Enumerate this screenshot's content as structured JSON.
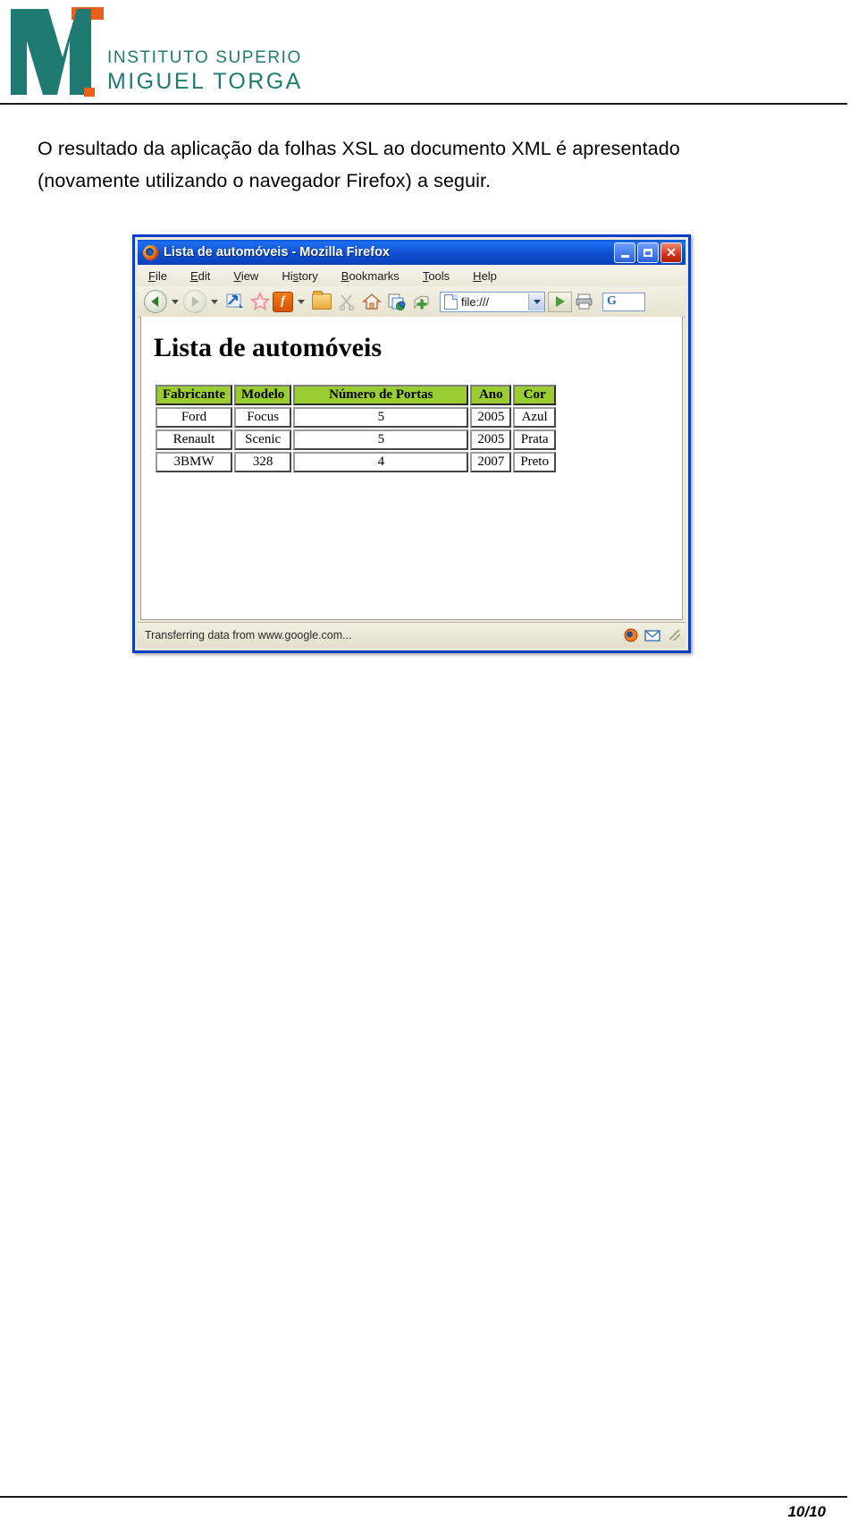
{
  "header": {
    "logo_alt": "Instituto Superior Miguel Torga",
    "logo_line1": "INSTITUTO SUPERIOR",
    "logo_line2": "MIGUEL TORGA",
    "logo_color_teal": "#1f7a73",
    "logo_color_orange": "#e8601c"
  },
  "paragraph": {
    "line1": "O resultado da aplicação da folhas XSL ao documento XML é apresentado",
    "line2": "(novamente utilizando o navegador Firefox) a seguir."
  },
  "browser": {
    "window_title": "Lista de automóveis - Mozilla Firefox",
    "window_buttons": {
      "minimize": "_",
      "maximize": "□",
      "close": "✕"
    },
    "menu": [
      {
        "label": "File",
        "accesskey": "F"
      },
      {
        "label": "Edit",
        "accesskey": "E"
      },
      {
        "label": "View",
        "accesskey": "V"
      },
      {
        "label": "History",
        "accesskey": "s"
      },
      {
        "label": "Bookmarks",
        "accesskey": "B"
      },
      {
        "label": "Tools",
        "accesskey": "T"
      },
      {
        "label": "Help",
        "accesskey": "H"
      }
    ],
    "toolbar": {
      "back_icon": "back-arrow-icon",
      "forward_icon": "forward-arrow-icon",
      "reload_icon": "reload-icon",
      "bookmark_star_icon": "star-icon",
      "firefox_f_button": "f",
      "open_folder_icon": "open-folder-icon",
      "cut_icon": "cut-icon",
      "home_icon": "home-icon",
      "page_copy_icon": "copy-page-icon",
      "add_icon": "add-green-plus-icon",
      "print_icon": "print-icon",
      "search_engine_letter": "G"
    },
    "address_bar": {
      "value": "file:///",
      "placeholder": "file:///"
    },
    "content": {
      "heading": "Lista de automóveis",
      "table": {
        "columns": [
          "Fabricante",
          "Modelo",
          "Número de Portas",
          "Ano",
          "Cor"
        ],
        "rows": [
          [
            "Ford",
            "Focus",
            "5",
            "2005",
            "Azul"
          ],
          [
            "Renault",
            "Scenic",
            "5",
            "2005",
            "Prata"
          ],
          [
            "3BMW",
            "328",
            "4",
            "2007",
            "Preto"
          ]
        ]
      }
    },
    "status_bar": {
      "text": "Transferring data from www.google.com...",
      "icons": [
        "firefox-status-icon",
        "mail-icon",
        "resize-grip-icon"
      ]
    }
  },
  "footer": {
    "page_number": "10/10"
  }
}
